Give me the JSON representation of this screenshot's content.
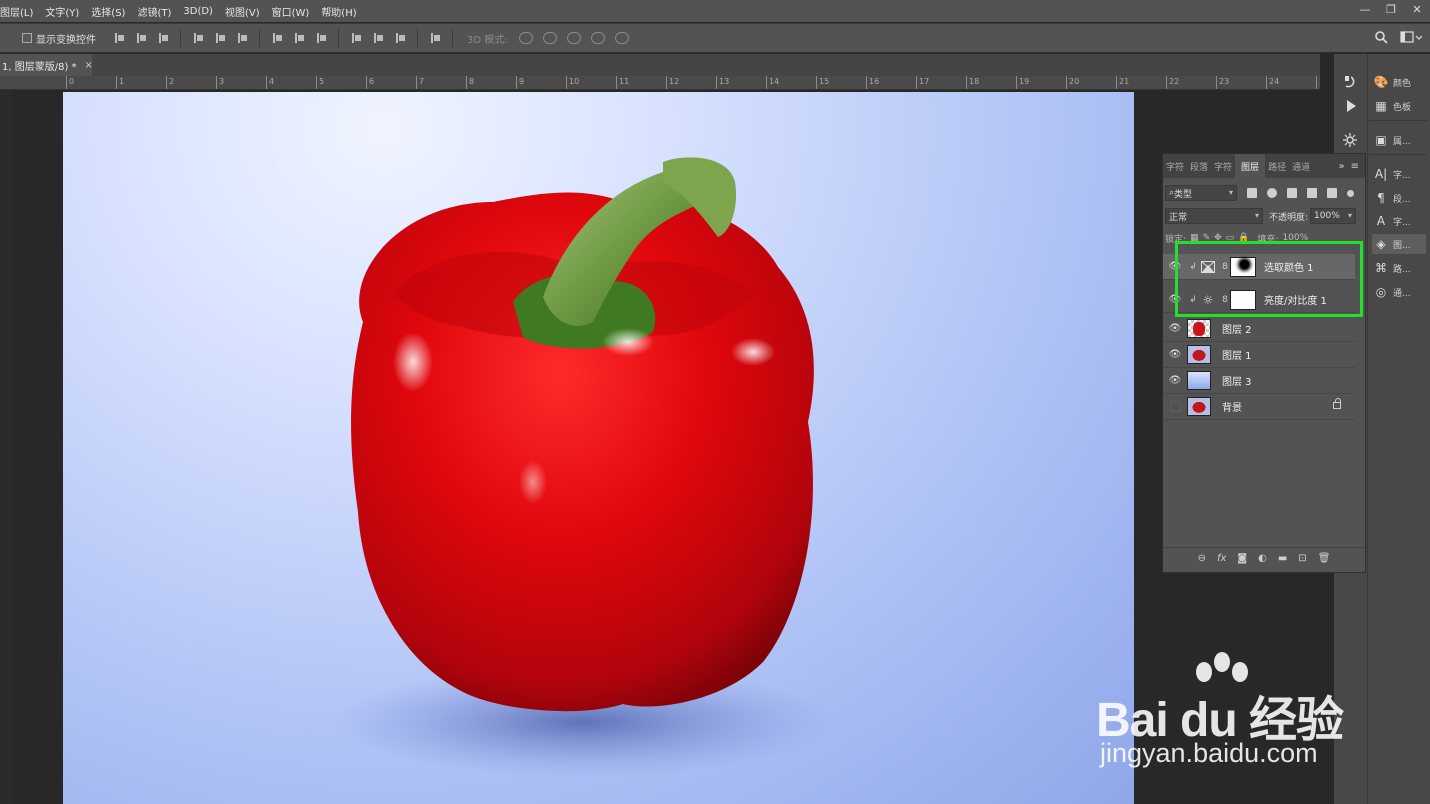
{
  "menu": [
    "图层(L)",
    "文字(Y)",
    "选择(S)",
    "滤镜(T)",
    "3D(D)",
    "视图(V)",
    "窗口(W)",
    "帮助(H)"
  ],
  "window_controls": [
    "—",
    "❐",
    "✕"
  ],
  "options": {
    "show_transform_label": "显示变换控件",
    "mode_3d_label": "3D 模式:"
  },
  "document_tab": {
    "title": "1, 图层蒙版/8) *",
    "close": "×"
  },
  "ruler_labels": [
    "0",
    "1",
    "2",
    "3",
    "4",
    "5",
    "6",
    "7",
    "8",
    "9",
    "10",
    "11",
    "12",
    "13",
    "14",
    "15",
    "16",
    "17",
    "18",
    "19",
    "20",
    "21",
    "22",
    "23",
    "24",
    "25"
  ],
  "right_dock": {
    "items": [
      {
        "glyph": "🎨",
        "label": "颜色"
      },
      {
        "glyph": "▦",
        "label": "色板"
      },
      {
        "glyph": "▣",
        "label": "属..."
      },
      {
        "glyph": "A|",
        "label": "字..."
      },
      {
        "glyph": "¶",
        "label": "段..."
      },
      {
        "glyph": "A",
        "label": "字..."
      },
      {
        "glyph": "◈",
        "label": "图..."
      },
      {
        "glyph": "⌘",
        "label": "路..."
      },
      {
        "glyph": "◎",
        "label": "通..."
      }
    ]
  },
  "layers_panel": {
    "tabs": [
      "字符",
      "段落",
      "字符",
      "图层",
      "路径",
      "通道"
    ],
    "active_tab": "图层",
    "more": "»",
    "filter_kind": "类型",
    "blend_mode": "正常",
    "opacity_label": "不透明度:",
    "opacity_value": "100%",
    "lock_label": "锁定:",
    "fill_label": "填充:",
    "fill_value": "100%",
    "layers": [
      {
        "name": "选取颜色 1",
        "type": "adjustment",
        "clipped": true,
        "visible": true,
        "selected": true,
        "icon": "selective-color-icon",
        "mask": "dot"
      },
      {
        "name": "亮度/对比度 1",
        "type": "adjustment",
        "clipped": true,
        "visible": true,
        "selected": false,
        "icon": "brightness-contrast-icon",
        "mask": "white"
      },
      {
        "name": "图层 2",
        "type": "pixel",
        "visible": true,
        "thumb": "checker"
      },
      {
        "name": "图层 1",
        "type": "pixel",
        "visible": true,
        "thumb": "pepper"
      },
      {
        "name": "图层 3",
        "type": "pixel",
        "visible": true,
        "thumb": "gradient"
      },
      {
        "name": "背景",
        "type": "background",
        "visible": false,
        "thumb": "pepper",
        "locked": true
      }
    ],
    "footer_icons": [
      "link-icon",
      "fx-icon",
      "mask-icon",
      "adjustment-icon",
      "folder-icon",
      "new-layer-icon",
      "trash-icon"
    ]
  },
  "watermark": {
    "logo": "Bai du 经验",
    "url": "jingyan.baidu.com"
  },
  "colors": {
    "highlight": "#22e12a",
    "panel": "#535353"
  }
}
